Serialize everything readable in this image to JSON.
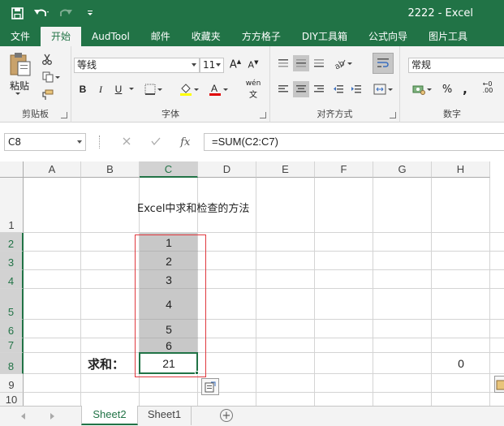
{
  "window": {
    "title": "2222 - Excel"
  },
  "tabs": [
    "文件",
    "开始",
    "AudTool",
    "邮件",
    "收藏夹",
    "方方格子",
    "DIY工具箱",
    "公式向导",
    "图片工具"
  ],
  "active_tab": 1,
  "ribbon": {
    "clipboard": {
      "paste_label": "粘贴",
      "group_label": "剪贴板"
    },
    "font": {
      "font_name": "等线",
      "font_size": "11",
      "bold": "B",
      "italic": "I",
      "underline": "U",
      "phonetic": "wén",
      "group_label": "字体"
    },
    "alignment": {
      "group_label": "对齐方式"
    },
    "number": {
      "format": "常规",
      "percent": "%",
      "comma": ",",
      "group_label": "数字"
    }
  },
  "formula_bar": {
    "name_box": "C8",
    "fx": "fx",
    "formula": "=SUM(C2:C7)"
  },
  "grid": {
    "columns": [
      "A",
      "B",
      "C",
      "D",
      "E",
      "F",
      "G",
      "H"
    ],
    "rows": [
      "1",
      "2",
      "3",
      "4",
      "5",
      "6",
      "7",
      "8",
      "9",
      "10"
    ],
    "title": "Excel中求和检查的方法",
    "values": [
      "1",
      "2",
      "3",
      "4",
      "5",
      "6"
    ],
    "sum_label": "求和：",
    "sum_value": "21",
    "h8_value": "0"
  },
  "sheets": [
    "Sheet2",
    "Sheet1"
  ],
  "active_sheet": 0,
  "colors": {
    "accent": "#217346",
    "highlight": "#c8c8c8",
    "red_box": "#e0393e"
  }
}
